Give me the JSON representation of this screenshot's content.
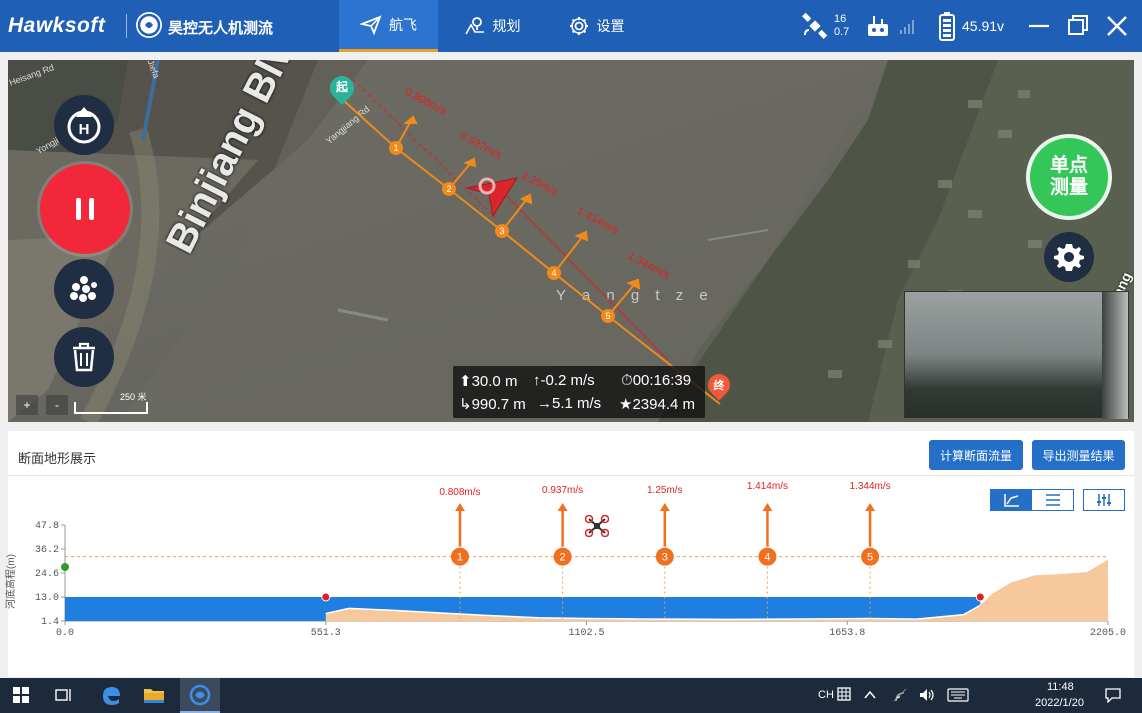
{
  "header": {
    "brand": "Hawksoft",
    "app_name": "昊控无人机测流",
    "tabs": [
      {
        "label": "航飞",
        "icon": "send-icon",
        "active": true
      },
      {
        "label": "规划",
        "icon": "plan-icon",
        "active": false
      },
      {
        "label": "设置",
        "icon": "gear-icon",
        "active": false
      }
    ],
    "satellite_count": "16",
    "satellite_hdop": "0.7",
    "battery_voltage": "45.91v",
    "accent": "#1f5fb5"
  },
  "map": {
    "start_marker": "起",
    "end_marker": "终",
    "river_label": "Y a n g t z e",
    "road_label": "Binjiang Blvd",
    "road_label_small": "Yangjiang Rd",
    "road_label_small2": "Yongjiu Ro",
    "road_label_small3": "Yanjiang Rd",
    "road_label_top": "Heisang Rd",
    "road_label_top2": "Jiefa",
    "road_label_right": "Binjiang",
    "scale_label": "250 米",
    "zoom_in": "+",
    "zoom_out": "-",
    "points": [
      {
        "n": "1",
        "speed": "0.808m/s"
      },
      {
        "n": "2",
        "speed": "0.937m/s"
      },
      {
        "n": "3",
        "speed": "1.25m/s"
      },
      {
        "n": "4",
        "speed": "1.414m/s"
      },
      {
        "n": "5",
        "speed": "1.344m/s"
      }
    ],
    "single_point_label_1": "单点",
    "single_point_label_2": "测量"
  },
  "telemetry": {
    "altitude": "30.0 m",
    "vertical_speed": "-0.2 m/s",
    "flight_time": "00:16:39",
    "distance": "990.7 m",
    "horizontal_speed": "5.1 m/s",
    "home_distance": "2394.4 m"
  },
  "profile": {
    "title": "断面地形展示",
    "btn_calc": "计算断面流量",
    "btn_export": "导出测量结果",
    "ylabel": "河底高程(m)",
    "yticks": [
      "47.8",
      "36.2",
      "24.6",
      "13.0",
      "1.4"
    ],
    "xticks": [
      "0.0",
      "551.3",
      "1102.5",
      "1653.8",
      "2205.0"
    ]
  },
  "chart_data": {
    "type": "area",
    "ylabel": "河底高程(m)",
    "xlim": [
      0,
      2205
    ],
    "ylim": [
      1.4,
      47.8
    ],
    "water_level": 13.0,
    "flight_height": 32.5,
    "bank_left_x": 551.3,
    "bank_right_x": 1935,
    "bed": [
      {
        "x": 551.3,
        "y": 5.0
      },
      {
        "x": 600,
        "y": 7.5
      },
      {
        "x": 700,
        "y": 6.5
      },
      {
        "x": 800,
        "y": 5.2
      },
      {
        "x": 900,
        "y": 4.0
      },
      {
        "x": 1000,
        "y": 3.0
      },
      {
        "x": 1100,
        "y": 2.6
      },
      {
        "x": 1200,
        "y": 2.4
      },
      {
        "x": 1300,
        "y": 2.3
      },
      {
        "x": 1400,
        "y": 2.2
      },
      {
        "x": 1500,
        "y": 2.3
      },
      {
        "x": 1600,
        "y": 2.4
      },
      {
        "x": 1700,
        "y": 2.6
      },
      {
        "x": 1800,
        "y": 2.3
      },
      {
        "x": 1900,
        "y": 4.5
      },
      {
        "x": 1935,
        "y": 9.0
      },
      {
        "x": 1960,
        "y": 14.5
      },
      {
        "x": 2000,
        "y": 20.0
      },
      {
        "x": 2050,
        "y": 23.5
      },
      {
        "x": 2100,
        "y": 24.0
      },
      {
        "x": 2160,
        "y": 25.0
      },
      {
        "x": 2205,
        "y": 31.0
      }
    ],
    "stations": [
      {
        "label": "1",
        "x": 835,
        "speed": "0.808m/s"
      },
      {
        "label": "2",
        "x": 1052,
        "speed": "0.937m/s"
      },
      {
        "label": "3",
        "x": 1268,
        "speed": "1.25m/s"
      },
      {
        "label": "4",
        "x": 1485,
        "speed": "1.414m/s"
      },
      {
        "label": "5",
        "x": 1702,
        "speed": "1.344m/s"
      }
    ],
    "colors": {
      "water": "#1f7fe0",
      "bank": "#f7c89b",
      "station": "#f07020",
      "speed": "#e02020"
    }
  },
  "taskbar": {
    "ime": "CH",
    "time": "11:48",
    "date": "2022/1/20"
  }
}
